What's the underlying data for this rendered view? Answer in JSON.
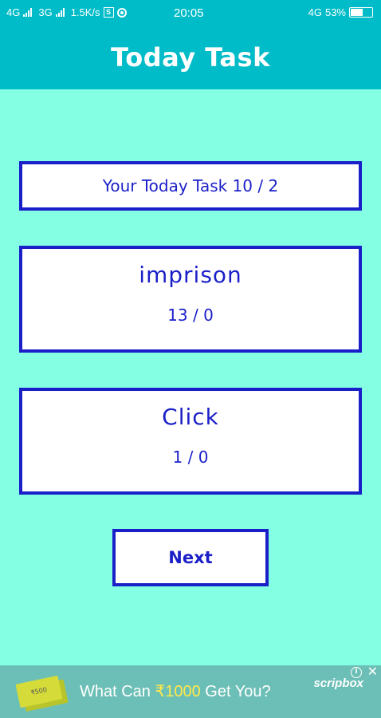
{
  "status_bar": {
    "net1": "4G",
    "net2": "3G",
    "speed": "1.5K/s",
    "s_icon": "S",
    "time": "20:05",
    "net3": "4G",
    "battery": "53%",
    "battery_level": 0.53
  },
  "app_bar": {
    "title": "Today Task"
  },
  "task_summary": {
    "label": "Your Today Task 10 / 2"
  },
  "word_card": {
    "word": "imprison",
    "count": "13 / 0"
  },
  "click_card": {
    "label": "Click",
    "count": "1 / 0"
  },
  "next_button": {
    "label": "Next"
  },
  "ad": {
    "note_text": "₹500",
    "text_before": "What Can ",
    "amount": "₹1000",
    "text_after": " Get You?",
    "brand": "scripbox",
    "info_icon": "info-icon",
    "close_icon": "close-icon",
    "amount_color": "#ffe94a"
  },
  "colors": {
    "background": "#84ffe3",
    "header": "#00bcc8",
    "accent": "#1a1fc8"
  }
}
